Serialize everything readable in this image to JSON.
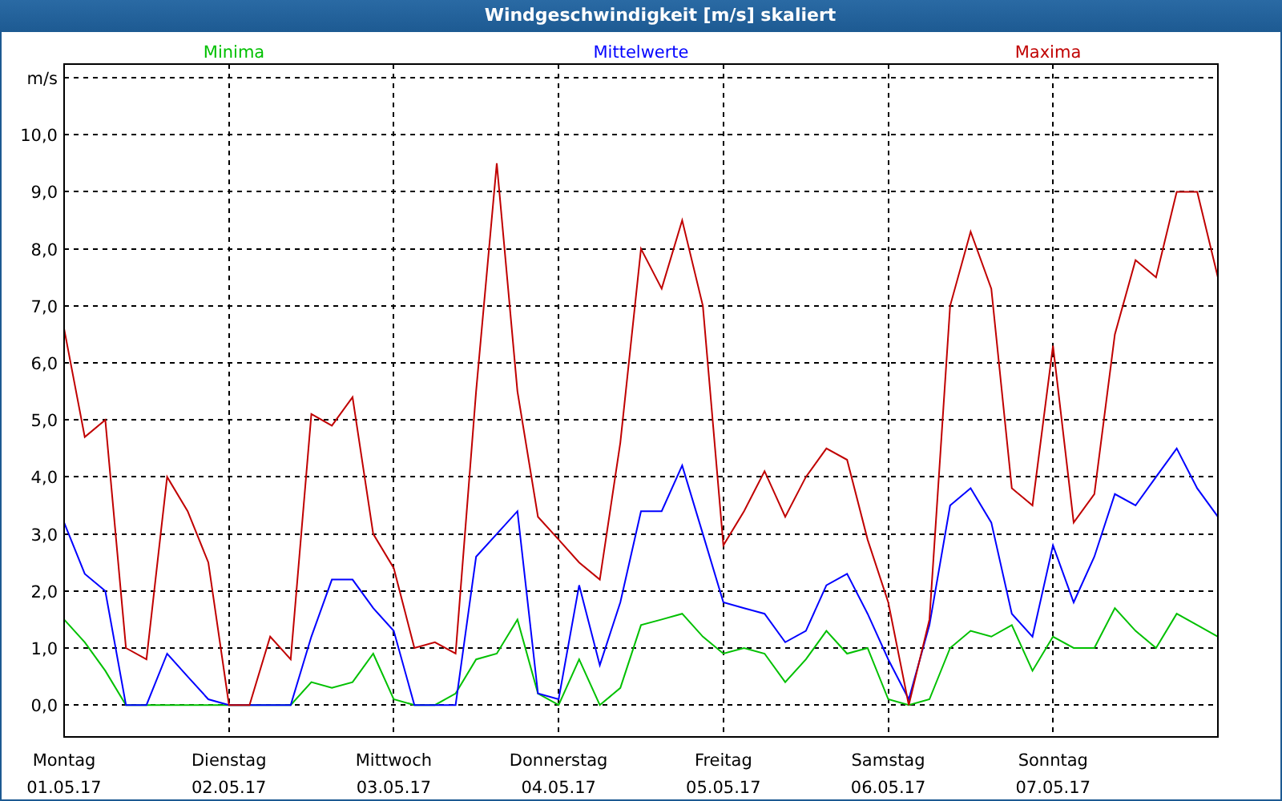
{
  "window": {
    "title": "Windgeschwindigkeit [m/s] skaliert"
  },
  "chart": {
    "chart_data": {
      "type": "line",
      "ylabel": "m/s",
      "grid": true,
      "categories": [
        "Montag",
        null,
        null,
        null,
        null,
        null,
        null,
        null,
        "Dienstag",
        null,
        null,
        null,
        null,
        null,
        null,
        null,
        "Mittwoch",
        null,
        null,
        null,
        null,
        null,
        null,
        null,
        "Donnerstag",
        null,
        null,
        null,
        null,
        null,
        null,
        null,
        "Freitag",
        null,
        null,
        null,
        null,
        null,
        null,
        null,
        "Samstag",
        null,
        null,
        null,
        null,
        null,
        null,
        null,
        "Sonntag",
        null,
        null,
        null,
        null,
        null,
        null,
        null,
        null
      ],
      "series": [
        {
          "name": "Minima",
          "color": "#00c000",
          "values": [
            1.5,
            1.1,
            0.6,
            0,
            0,
            0,
            0,
            0,
            0,
            0,
            0,
            0,
            0.4,
            0.3,
            0.4,
            0.9,
            0.1,
            0,
            0,
            0.2,
            0.8,
            0.9,
            1.5,
            0.2,
            0,
            0.8,
            0,
            0.3,
            1.4,
            1.5,
            1.6,
            1.2,
            0.9,
            1.0,
            0.9,
            0.4,
            0.8,
            1.3,
            0.9,
            1.0,
            0.1,
            0,
            0.1,
            1.0,
            1.3,
            1.2,
            1.4,
            0.6,
            1.2,
            1.0,
            1.0,
            1.7,
            1.3,
            1.0,
            1.6,
            1.4,
            1.2
          ]
        },
        {
          "name": "Mittelwerte",
          "color": "#0000ff",
          "values": [
            3.2,
            2.3,
            2.0,
            0,
            0,
            0.9,
            0.5,
            0.1,
            0,
            0,
            0,
            0,
            1.2,
            2.2,
            2.2,
            1.7,
            1.3,
            0,
            0,
            0,
            2.6,
            3.0,
            3.4,
            0.2,
            0.1,
            2.1,
            0.7,
            1.8,
            3.4,
            3.4,
            4.2,
            3.0,
            1.8,
            1.7,
            1.6,
            1.1,
            1.3,
            2.1,
            2.3,
            1.6,
            0.8,
            0.1,
            1.4,
            3.5,
            3.8,
            3.2,
            1.6,
            1.2,
            2.8,
            1.8,
            2.6,
            3.7,
            3.5,
            4.0,
            4.5,
            3.8,
            3.3
          ]
        },
        {
          "name": "Maxima",
          "color": "#c00000",
          "values": [
            6.6,
            4.7,
            5.0,
            1.0,
            0.8,
            4.0,
            3.4,
            2.5,
            0,
            0,
            1.2,
            0.8,
            5.1,
            4.9,
            5.4,
            3.0,
            2.4,
            1.0,
            1.1,
            0.9,
            5.5,
            9.5,
            5.5,
            3.3,
            2.9,
            2.5,
            2.2,
            4.6,
            8.0,
            7.3,
            8.5,
            7.0,
            2.8,
            3.4,
            4.1,
            3.3,
            4.0,
            4.5,
            4.3,
            2.9,
            1.8,
            0,
            1.5,
            7.0,
            8.3,
            7.3,
            3.8,
            3.5,
            6.3,
            3.2,
            3.7,
            6.5,
            7.8,
            7.5,
            9.0,
            9.0,
            7.5
          ]
        }
      ],
      "ylim": [
        -0.56,
        11.24
      ],
      "yticks": [
        {
          "value": 0,
          "label": "0,0"
        },
        {
          "value": 1,
          "label": "1,0"
        },
        {
          "value": 2,
          "label": "2,0"
        },
        {
          "value": 3,
          "label": "3,0"
        },
        {
          "value": 4,
          "label": "4,0"
        },
        {
          "value": 5,
          "label": "5,0"
        },
        {
          "value": 6,
          "label": "6,0"
        },
        {
          "value": 7,
          "label": "7,0"
        },
        {
          "value": 8,
          "label": "8,0"
        },
        {
          "value": 9,
          "label": "9,0"
        },
        {
          "value": 10,
          "label": "10,0"
        }
      ]
    },
    "date_labels": [
      "01.05.17",
      "02.05.17",
      "03.05.17",
      "04.05.17",
      "05.05.17",
      "06.05.17",
      "07.05.17"
    ]
  }
}
